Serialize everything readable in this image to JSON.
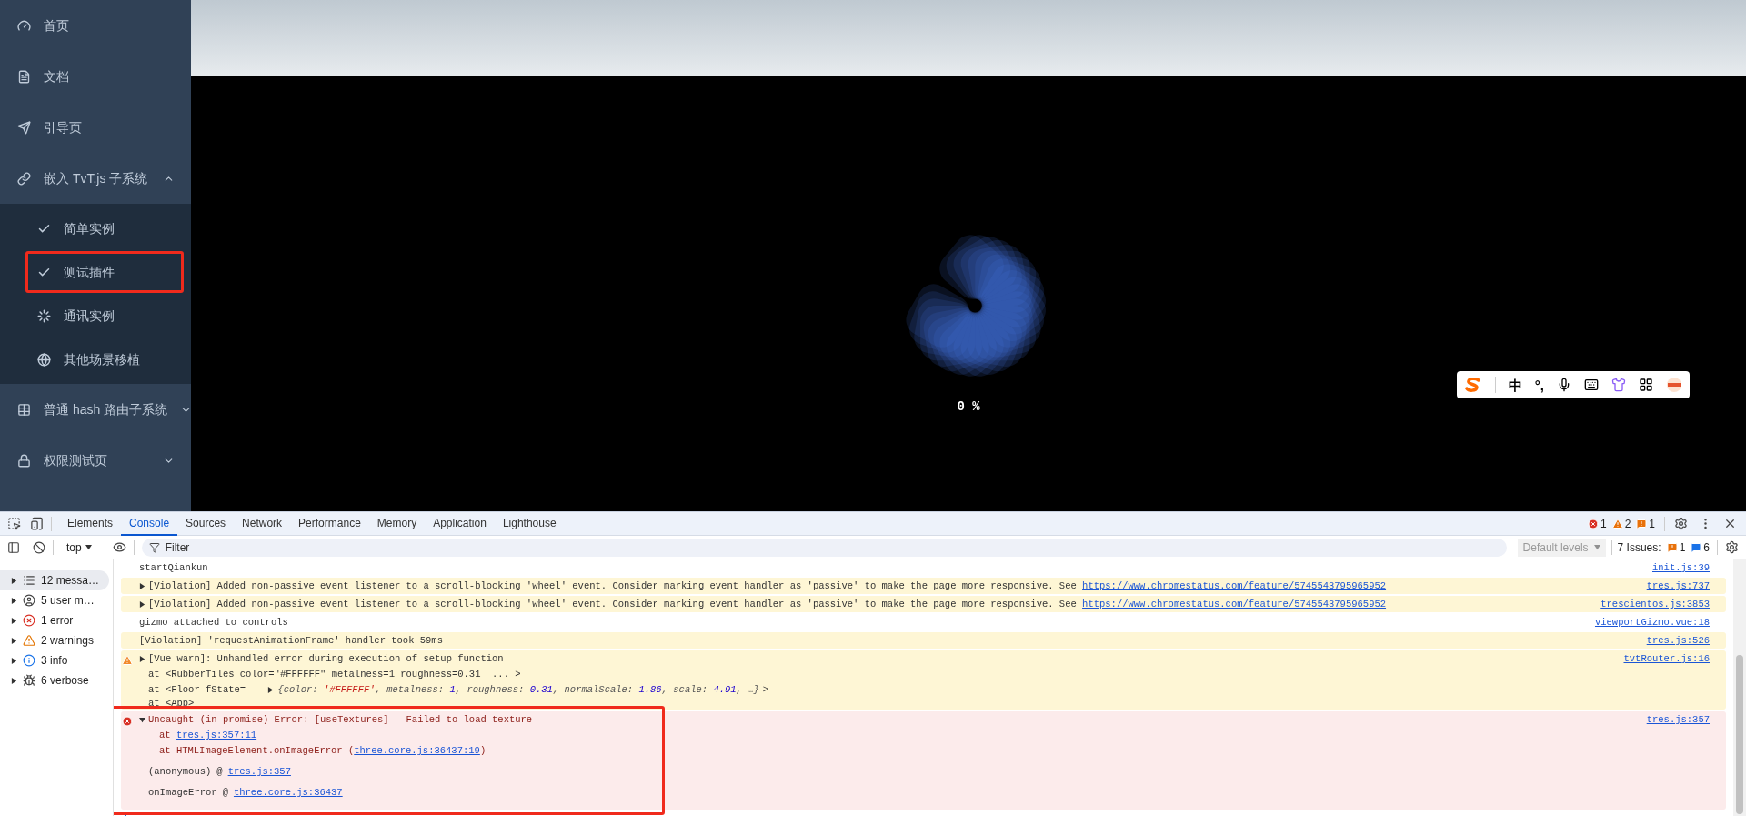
{
  "sidebar": {
    "items": [
      {
        "label": "首页"
      },
      {
        "label": "文档"
      },
      {
        "label": "引导页"
      },
      {
        "label": "嵌入 TvT.js 子系统",
        "expanded": true,
        "children": [
          {
            "label": "简单实例",
            "highlighted": false
          },
          {
            "label": "测试插件",
            "highlighted": true
          },
          {
            "label": "通讯实例",
            "highlighted": false
          },
          {
            "label": "其他场景移植",
            "highlighted": false
          }
        ]
      },
      {
        "label": "普通 hash 路由子系统",
        "expanded": false
      },
      {
        "label": "权限测试页",
        "expanded": false
      }
    ]
  },
  "viewport": {
    "progress": "0 %",
    "ime_toolbar": {
      "items": [
        "中",
        "°,"
      ]
    }
  },
  "devtools": {
    "tabs": [
      {
        "label": "Elements",
        "selected": false
      },
      {
        "label": "Console",
        "selected": true
      },
      {
        "label": "Sources",
        "selected": false
      },
      {
        "label": "Network",
        "selected": false
      },
      {
        "label": "Performance",
        "selected": false
      },
      {
        "label": "Memory",
        "selected": false
      },
      {
        "label": "Application",
        "selected": false
      },
      {
        "label": "Lighthouse",
        "selected": false
      }
    ],
    "counts": {
      "errors": "1",
      "warnings": "2",
      "issues": "1"
    },
    "filter_bar": {
      "context": "top",
      "placeholder": "Filter",
      "levels": "Default levels",
      "issues_label": "7 Issues:",
      "issue_errors": "1",
      "issue_infos": "6"
    },
    "message_groups": [
      {
        "label": "12 messa…",
        "selected": true
      },
      {
        "label": "5 user m…",
        "selected": false
      },
      {
        "label": "1 error",
        "selected": false
      },
      {
        "label": "2 warnings",
        "selected": false
      },
      {
        "label": "3 info",
        "selected": false
      },
      {
        "label": "6 verbose",
        "selected": false
      }
    ],
    "logs": [
      {
        "kind": "log",
        "text": "startQiankun",
        "source": "init.js:39"
      },
      {
        "kind": "violation",
        "expandable": true,
        "text": "[Violation] Added non-passive event listener to a scroll-blocking 'wheel' event. Consider marking event handler as 'passive' to make the page more responsive. See ",
        "link": "https://www.chromestatus.com/feature/5745543795965952",
        "source": "tres.js:737"
      },
      {
        "kind": "violation",
        "expandable": true,
        "text": "[Violation] Added non-passive event listener to a scroll-blocking 'wheel' event. Consider marking event handler as 'passive' to make the page more responsive. See ",
        "link": "https://www.chromestatus.com/feature/5745543795965952",
        "source": "trescientos.js:3853"
      },
      {
        "kind": "log",
        "text": "gizmo attached to controls",
        "source": "viewportGizmo.vue:18"
      },
      {
        "kind": "violation",
        "expandable": false,
        "text": "[Violation] 'requestAnimationFrame' handler took 59ms",
        "source": "tres.js:526"
      },
      {
        "kind": "warn",
        "expandable": true,
        "text": "[Vue warn]: Unhandled error during execution of setup function",
        "source": "tvtRouter.js:16",
        "lines": [
          "at <RubberTiles color=\"#FFFFFF\" metalness=1 roughness=0.31  ... >",
          "at <Floor fState= "
        ],
        "preview": {
          "parts": [
            {
              "text": "{color: ",
              "kind": "plain"
            },
            {
              "text": "'#FFFFFF'",
              "kind": "string"
            },
            {
              "text": ", metalness: ",
              "kind": "plain"
            },
            {
              "text": "1",
              "kind": "number"
            },
            {
              "text": ", roughness: ",
              "kind": "plain"
            },
            {
              "text": "0.31",
              "kind": "number"
            },
            {
              "text": ", normalScale: ",
              "kind": "plain"
            },
            {
              "text": "1.86",
              "kind": "number"
            },
            {
              "text": ", scale: ",
              "kind": "plain"
            },
            {
              "text": "4.91",
              "kind": "number"
            },
            {
              "text": ", …}",
              "kind": "plain"
            }
          ],
          "after": ">"
        },
        "tail": "at <App>"
      },
      {
        "kind": "error",
        "expandable": true,
        "highlighted": true,
        "text": "Uncaught (in promise) Error: [useTextures] - Failed to load texture",
        "source": "tres.js:357",
        "stack": [
          {
            "prefix": "at ",
            "link": "tres.js:357:11"
          },
          {
            "prefix": "at HTMLImageElement.onImageError (",
            "link": "three.core.js:36437:19",
            "suffix": ")"
          }
        ],
        "frames": [
          {
            "name": "(anonymous)",
            "at": "@",
            "link": "tres.js:357"
          },
          {
            "name": "onImageError",
            "at": "@",
            "link": "three.core.js:36437"
          }
        ]
      }
    ]
  }
}
